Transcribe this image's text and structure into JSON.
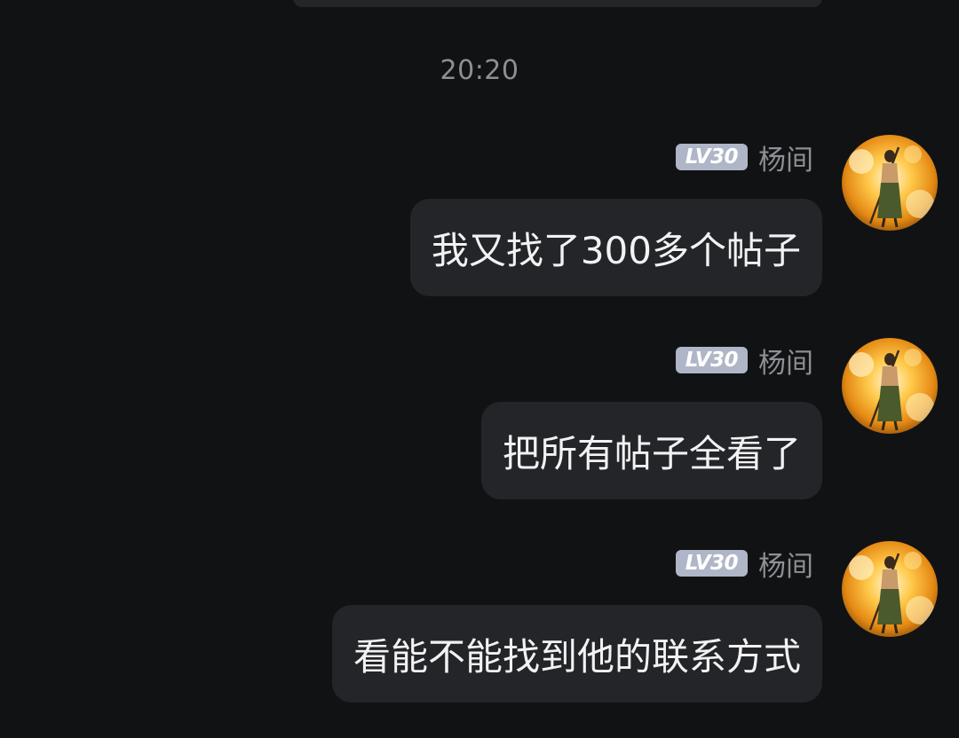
{
  "chat": {
    "timestamp": "20:20",
    "messages": [
      {
        "sender": "杨间",
        "level": "LV30",
        "text": "我又找了300多个帖子"
      },
      {
        "sender": "杨间",
        "level": "LV30",
        "text": "把所有帖子全看了"
      },
      {
        "sender": "杨间",
        "level": "LV30",
        "text": "看能不能找到他的联系方式"
      }
    ]
  },
  "colors": {
    "background": "#111214",
    "bubble": "#242528",
    "message_text": "#f2f2f4",
    "secondary_text": "#8e8f94",
    "level_badge": "#aeb6c7"
  },
  "icons": {
    "avatar": "avatar-figure-with-staff-golden-glow"
  }
}
